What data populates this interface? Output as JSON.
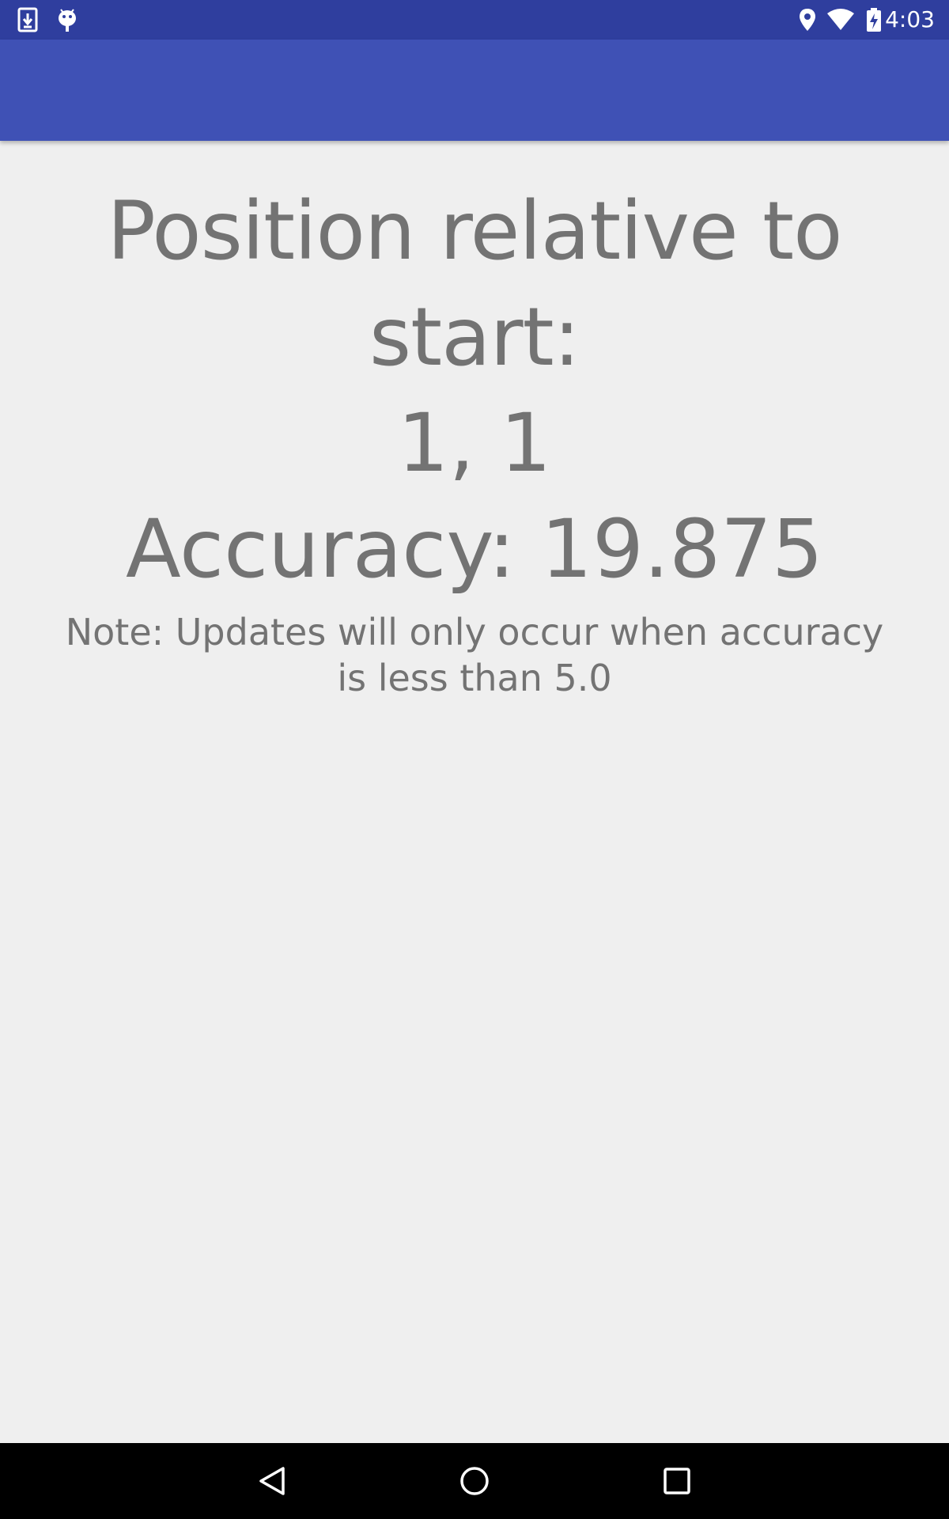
{
  "status_bar": {
    "time": "4:03",
    "left_icons": [
      "download-icon",
      "android-debug-icon"
    ],
    "right_icons": [
      "location-icon",
      "wifi-icon",
      "battery-charging-icon"
    ]
  },
  "app_bar": {
    "title": "",
    "color": "#3f51b5"
  },
  "main": {
    "position_label": "Position relative to start:",
    "position_value": "1, 1",
    "accuracy": "Accuracy: 19.875",
    "note": "Note: Updates will only occur when accuracy is less than  5.0"
  },
  "nav_bar": {
    "buttons": [
      "back-icon",
      "home-icon",
      "recents-icon"
    ]
  },
  "colors": {
    "status_bar": "#2f3e9e",
    "background": "#efefef",
    "text": "#737373"
  }
}
